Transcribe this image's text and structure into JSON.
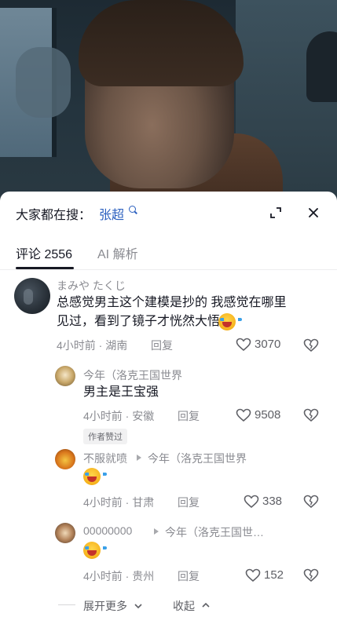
{
  "search": {
    "prefix": "大家都在搜：",
    "term": "张超"
  },
  "tabs": [
    {
      "label": "评论 2556"
    },
    {
      "label": "AI 解析"
    }
  ],
  "comments": [
    {
      "username": "まみや たくじ",
      "text_line1": "总感觉男主这个建模是抄的 我感觉在哪里",
      "text_line2": "见过，看到了镜子才恍然大悟",
      "meta": "4小时前 · 湖南",
      "reply_label": "回复",
      "likes": "3070"
    },
    {
      "username": "今年（洛克王国世界",
      "text": "男主是王宝强",
      "meta": "4小时前 · 安徽",
      "reply_label": "回复",
      "likes": "9508",
      "badge": "作者赞过"
    },
    {
      "username": "不服就喷",
      "reply_to": "今年（洛克王国世界",
      "meta": "4小时前 · 甘肃",
      "reply_label": "回复",
      "likes": "338"
    },
    {
      "username": "00000000",
      "reply_to": "今年（洛克王国世…",
      "meta": "4小时前 · 贵州",
      "reply_label": "回复",
      "likes": "152"
    }
  ],
  "footer": {
    "expand_more": "展开更多",
    "collapse": "收起"
  },
  "icons": {
    "search": "magnifier-icon",
    "collapse": "collapse-arrows-icon",
    "close": "close-icon",
    "like": "heart-icon",
    "dislike": "broken-heart-icon",
    "emoji": "laugh-cry-emoji-icon"
  },
  "colors": {
    "link": "#2a5fbf",
    "text": "#161823",
    "muted": "#8a8b91"
  }
}
